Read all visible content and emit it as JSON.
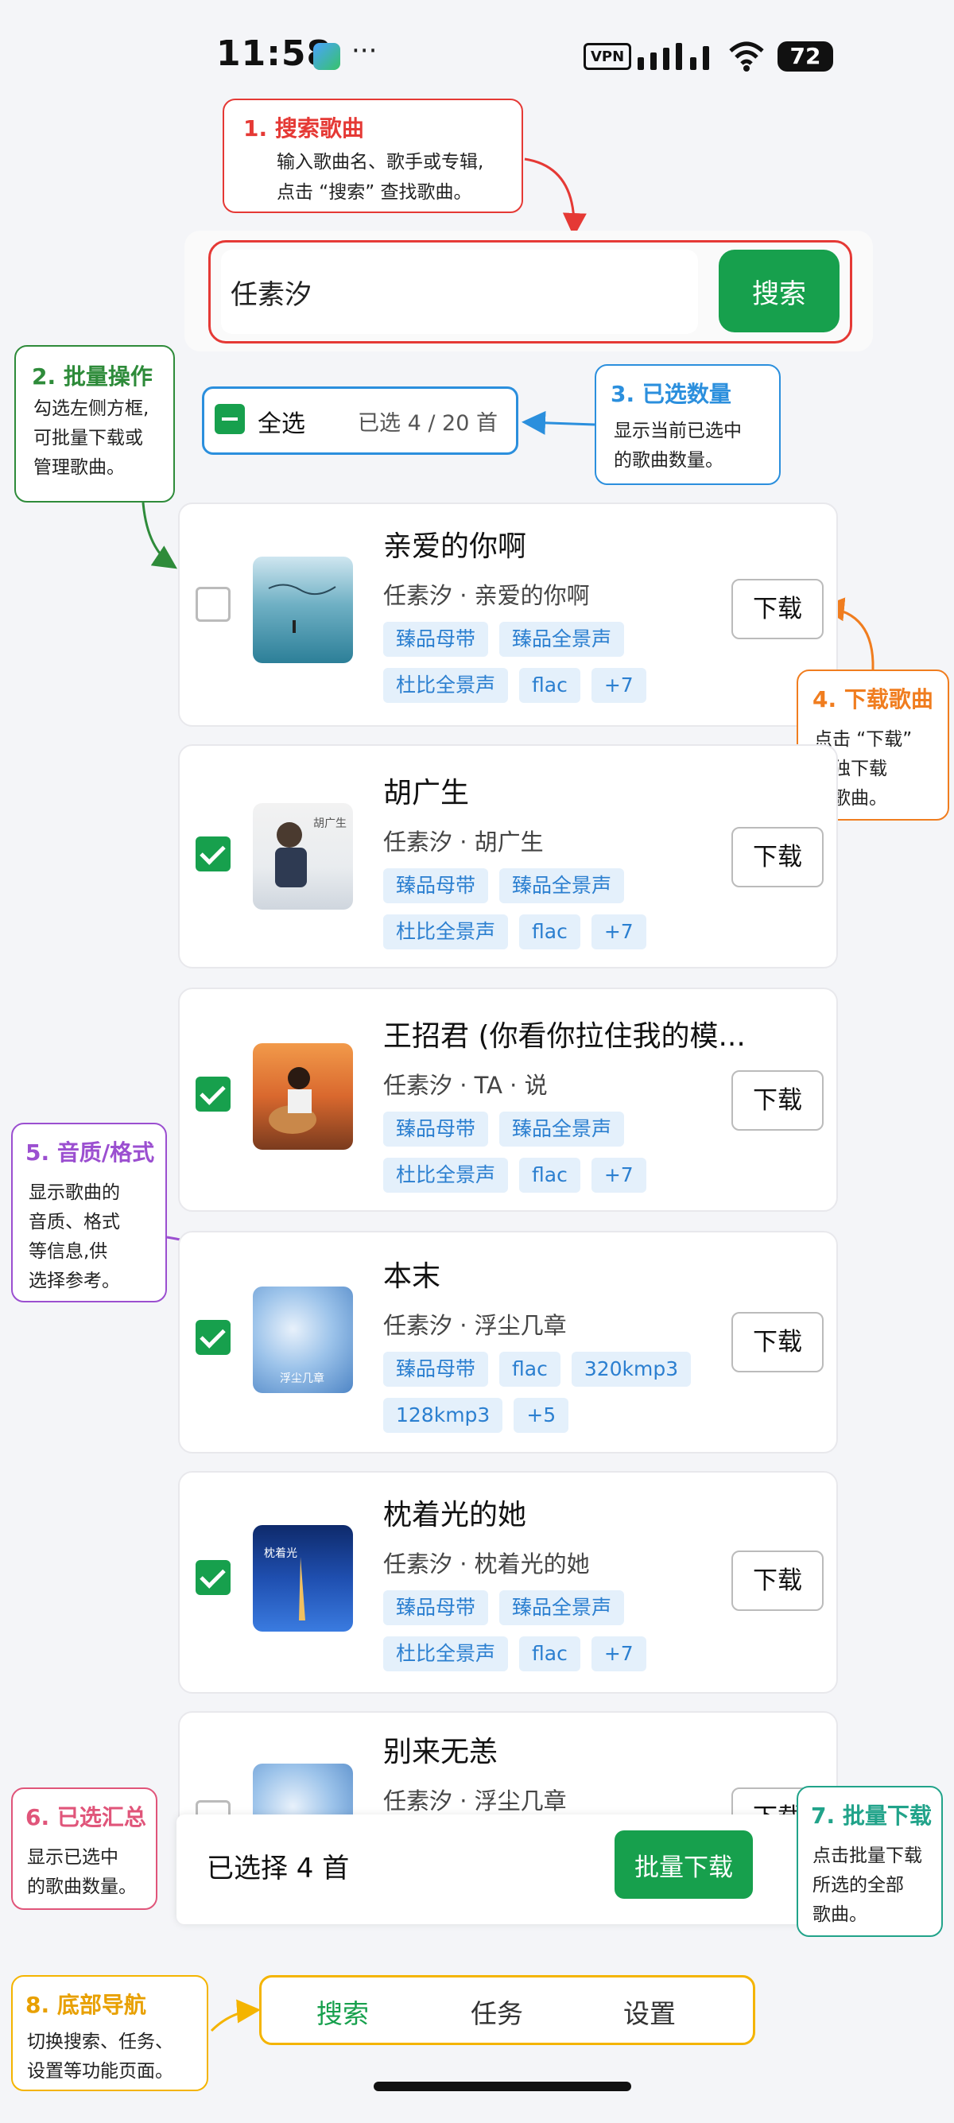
{
  "status_bar": {
    "time": "11:58",
    "dots": "···",
    "vpn": "VPN",
    "battery": "72"
  },
  "search": {
    "value": "任素汐",
    "button": "搜索"
  },
  "select_all": {
    "label": "全选",
    "count": "已选 4 / 20 首"
  },
  "songs": [
    {
      "title": "亲爱的你啊",
      "artist": "任素汐 · 亲爱的你啊",
      "tags": [
        "臻品母带",
        "臻品全景声",
        "杜比全景声",
        "flac",
        "+7"
      ],
      "checked": false,
      "download": "下载"
    },
    {
      "title": "胡广生",
      "artist": "任素汐 · 胡广生",
      "tags": [
        "臻品母带",
        "臻品全景声",
        "杜比全景声",
        "flac",
        "+7"
      ],
      "checked": true,
      "download": "下载"
    },
    {
      "title": "王招君 (你看你拉住我的模...",
      "artist": "任素汐 · TA · 说",
      "tags": [
        "臻品母带",
        "臻品全景声",
        "杜比全景声",
        "flac",
        "+7"
      ],
      "checked": true,
      "download": "下载"
    },
    {
      "title": "本末",
      "artist": "任素汐 · 浮尘几章",
      "tags": [
        "臻品母带",
        "flac",
        "320kmp3",
        "128kmp3",
        "+5"
      ],
      "checked": true,
      "download": "下载"
    },
    {
      "title": "枕着光的她",
      "artist": "任素汐 · 枕着光的她",
      "tags": [
        "臻品母带",
        "臻品全景声",
        "杜比全景声",
        "flac",
        "+7"
      ],
      "checked": true,
      "download": "下载"
    },
    {
      "title": "别来无恙",
      "artist": "任素汐 · 浮尘几章",
      "tags": [],
      "checked": false,
      "download": "下载"
    }
  ],
  "summary": {
    "text": "已选择 4 首",
    "batch_button": "批量下载"
  },
  "nav": {
    "search": "搜索",
    "tasks": "任务",
    "settings": "设置"
  },
  "annotations": {
    "a1": {
      "title": "1. 搜索歌曲",
      "l1": "输入歌曲名、歌手或专辑,",
      "l2": "点击 “搜索” 查找歌曲。"
    },
    "a2": {
      "title": "2. 批量操作",
      "l1": "勾选左侧方框,",
      "l2": "可批量下载或",
      "l3": "管理歌曲。"
    },
    "a3": {
      "title": "3. 已选数量",
      "l1": "显示当前已选中",
      "l2": "的歌曲数量。"
    },
    "a4": {
      "title": "4. 下载歌曲",
      "l1": "点击 “下载”",
      "l2": "单独下载",
      "l3": "该歌曲。"
    },
    "a5": {
      "title": "5. 音质/格式",
      "l1": "显示歌曲的",
      "l2": "音质、格式",
      "l3": "等信息,供",
      "l4": "选择参考。"
    },
    "a6": {
      "title": "6. 已选汇总",
      "l1": "显示已选中",
      "l2": "的歌曲数量。"
    },
    "a7": {
      "title": "7. 批量下载",
      "l1": "点击批量下载",
      "l2": "所选的全部",
      "l3": "歌曲。"
    },
    "a8": {
      "title": "8. 底部导航",
      "l1": "切换搜索、任务、",
      "l2": "设置等功能页面。"
    }
  },
  "colors": {
    "accent_green": "#17a04d",
    "tag_blue": "#2b7fd0",
    "search_red": "#e53935"
  }
}
